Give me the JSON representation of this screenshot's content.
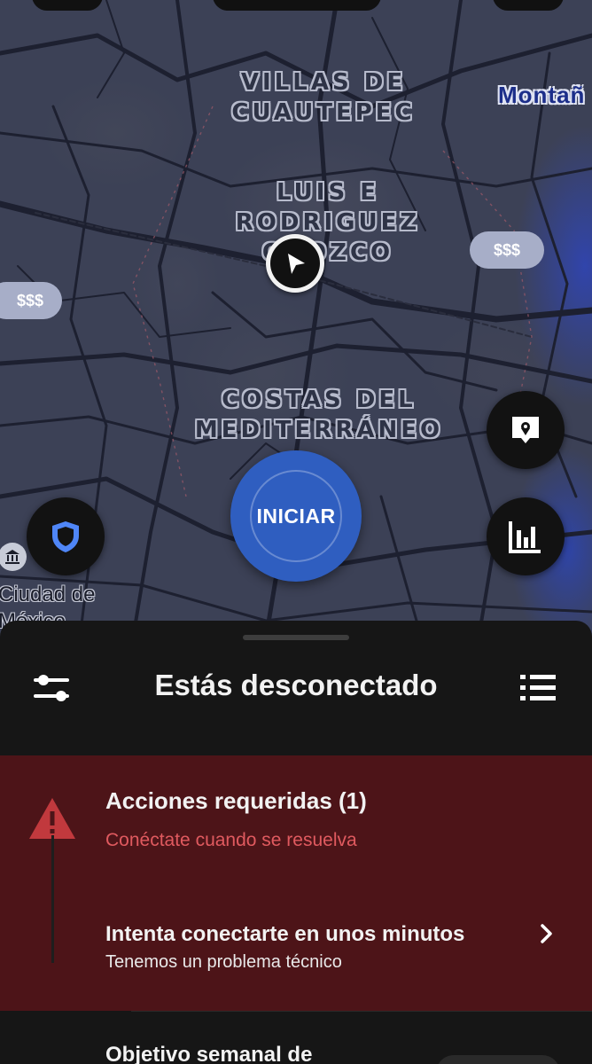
{
  "map": {
    "labels": {
      "villas": "VILLAS DE\nCUAUTEPEC",
      "luis": "LUIS E\nRODRIGUEZ\nOROZCO",
      "costas": "COSTAS DEL\nMEDITERRÁNEO",
      "montana": "Montañ",
      "cdmx": "Ciudad de\nMéxico"
    },
    "price_right": "$$$",
    "price_left": "$$$",
    "start_button": "INICIAR",
    "icons": {
      "location": "navigation-arrow-icon",
      "report": "map-pin-message-icon",
      "stats": "bar-chart-icon",
      "safety": "shield-icon",
      "poi": "museum-icon"
    }
  },
  "sheet": {
    "title": "Estás desconectado",
    "icons": {
      "left": "filters-icon",
      "right": "list-icon"
    }
  },
  "alert": {
    "title": "Acciones requeridas (1)",
    "subtitle": "Conéctate cuando se resuelva",
    "row_title": "Intenta conectarte en unos minutos",
    "row_subtitle": "Tenemos un problema técnico",
    "icon": "warning-icon",
    "color": "#4d1418",
    "accent": "#e05a5f"
  },
  "next_section": {
    "title": "Objetivo semanal de"
  },
  "colors": {
    "start_button": "#2f5ec0",
    "sheet_bg": "#161616",
    "map_bg": "#3c4156"
  }
}
